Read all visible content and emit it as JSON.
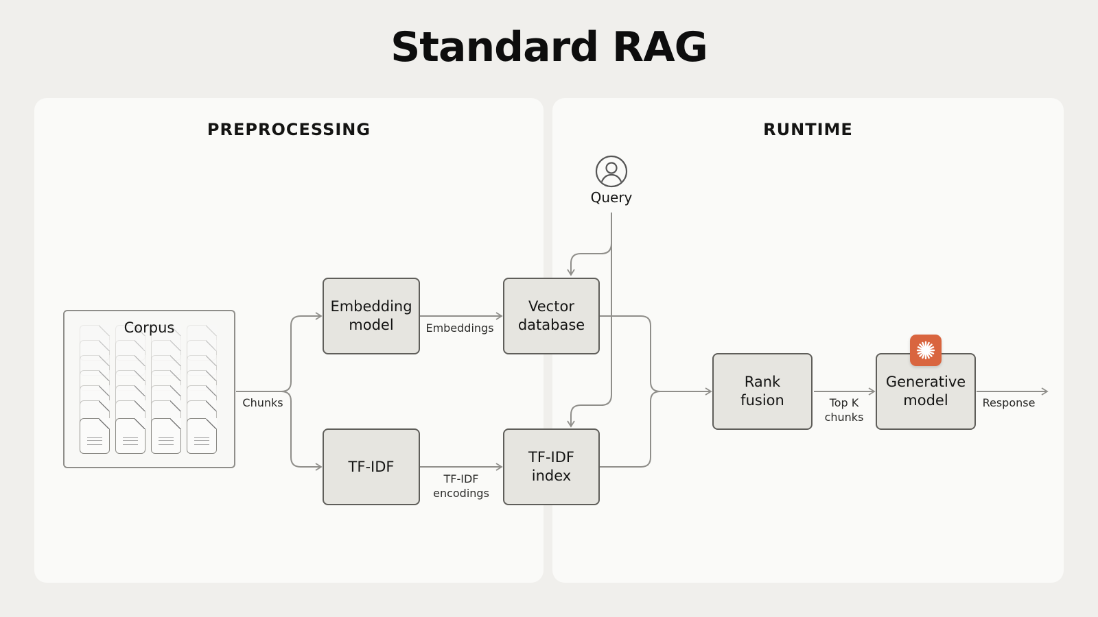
{
  "title": "Standard RAG",
  "panels": {
    "preprocessing": {
      "title": "PREPROCESSING"
    },
    "runtime": {
      "title": "RUNTIME"
    }
  },
  "nodes": {
    "corpus": "Corpus",
    "embedding_model": "Embedding\nmodel",
    "tfidf": "TF-IDF",
    "vector_database": "Vector\ndatabase",
    "tfidf_index": "TF-IDF\nindex",
    "rank_fusion": "Rank\nfusion",
    "generative_model": "Generative\nmodel",
    "query": "Query"
  },
  "edges": {
    "chunks": "Chunks",
    "embeddings": "Embeddings",
    "tfidf_encodings": "TF-IDF\nencodings",
    "top_k_chunks": "Top K\nchunks",
    "response": "Response"
  },
  "icons": {
    "query": "user-circle-icon",
    "generative_model": "claude-sparkle-icon"
  },
  "colors": {
    "background": "#f0efec",
    "panel": "#fafaf8",
    "box_fill": "#e6e5e0",
    "box_border": "#5f5e5a",
    "arrow": "#8f8e8a",
    "accent": "#d9653f"
  }
}
